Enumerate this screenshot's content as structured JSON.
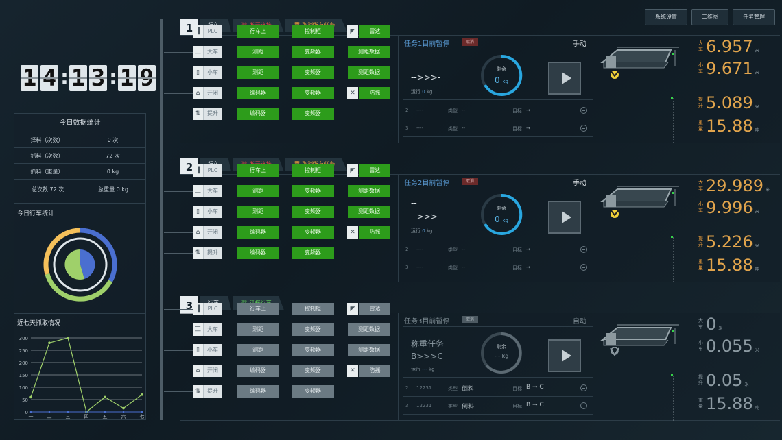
{
  "clock": {
    "digits": [
      "1",
      "4",
      "1",
      "3",
      "1",
      "9"
    ]
  },
  "top_buttons": [
    "系统设置",
    "二维图",
    "任务管理"
  ],
  "stats": {
    "title": "今日数据统计",
    "rows": [
      {
        "label": "择料（次数）",
        "value": "0 次"
      },
      {
        "label": "抓料（次数）",
        "value": "72 次"
      },
      {
        "label": "抓料（重量）",
        "value": "0 kg"
      }
    ],
    "total_count": "总次数  72 次",
    "total_weight": "总重量  0 kg"
  },
  "donut": {
    "title": "今日行车统计",
    "colors": [
      "#4a6fd0",
      "#9fd06a",
      "#f5c05a"
    ]
  },
  "line_chart": {
    "title": "近七天抓取情况"
  },
  "chart_data": {
    "type": "line",
    "title": "近七天抓取情况",
    "categories": [
      "一",
      "二",
      "三",
      "四",
      "五",
      "六",
      "七"
    ],
    "values": [
      60,
      280,
      300,
      0,
      60,
      15,
      70
    ],
    "ylim": [
      0,
      300
    ],
    "yticks": [
      0,
      50,
      100,
      150,
      200,
      250,
      300
    ],
    "grid": true,
    "color": "#9fd06a"
  },
  "sections": [
    {
      "num": "1",
      "tabs": [
        "行车",
        "断开连接",
        "取消所有任务"
      ],
      "devices": [
        "PLC",
        "大车",
        "小车",
        "开闭",
        "提升"
      ],
      "col1": [
        "行车上",
        "测距",
        "测距",
        "编码器",
        "编码器"
      ],
      "col2": [
        "控制柜",
        "变频器",
        "变频器",
        "变频器",
        "变频器"
      ],
      "col3": [
        "雷达",
        "测距数据",
        "测距数据",
        "防摇"
      ],
      "task": {
        "title": "任务1目前暂停",
        "cancel": "取消",
        "mode": "手动",
        "line1": "--",
        "line2": "-->>>-",
        "run": "运行",
        "run_val": "0",
        "run_unit": "kg",
        "gauge_label": "剩余",
        "gauge_value": "0",
        "gauge_unit": "kg",
        "rows": [
          {
            "n": "2",
            "id": "----",
            "type_l": "类型",
            "type_v": "--",
            "tgt_l": "目标",
            "tgt_v": "→"
          },
          {
            "n": "3",
            "id": "----",
            "type_l": "类型",
            "type_v": "--",
            "tgt_l": "目标",
            "tgt_v": "→"
          }
        ]
      },
      "readouts": [
        {
          "label": "大车",
          "value": "6.957",
          "unit": "米"
        },
        {
          "label": "小车",
          "value": "9.671",
          "unit": "米"
        },
        {
          "label": "提升",
          "value": "5.089",
          "unit": "米"
        },
        {
          "label": "重量",
          "value": "15.88",
          "unit": "吨"
        }
      ]
    },
    {
      "num": "2",
      "tabs": [
        "行车",
        "断开连接",
        "取消所有任务"
      ],
      "devices": [
        "PLC",
        "大车",
        "小车",
        "开闭",
        "提升"
      ],
      "col1": [
        "行车上",
        "测距",
        "测距",
        "编码器",
        "编码器"
      ],
      "col2": [
        "控制柜",
        "变频器",
        "变频器",
        "变频器",
        "变频器"
      ],
      "col3": [
        "雷达",
        "测距数据",
        "测距数据",
        "防摇"
      ],
      "task": {
        "title": "任务2目前暂停",
        "cancel": "取消",
        "mode": "手动",
        "line1": "--",
        "line2": "-->>>-",
        "run": "运行",
        "run_val": "0",
        "run_unit": "kg",
        "gauge_label": "剩余",
        "gauge_value": "0",
        "gauge_unit": "kg",
        "rows": [
          {
            "n": "2",
            "id": "----",
            "type_l": "类型",
            "type_v": "--",
            "tgt_l": "目标",
            "tgt_v": "→"
          },
          {
            "n": "3",
            "id": "----",
            "type_l": "类型",
            "type_v": "--",
            "tgt_l": "目标",
            "tgt_v": "→"
          }
        ]
      },
      "readouts": [
        {
          "label": "大车",
          "value": "29.989",
          "unit": "米"
        },
        {
          "label": "小车",
          "value": "9.996",
          "unit": "米"
        },
        {
          "label": "提升",
          "value": "5.226",
          "unit": "米"
        },
        {
          "label": "重量",
          "value": "15.88",
          "unit": "吨"
        }
      ]
    },
    {
      "num": "3",
      "tabs": [
        "行车",
        "连接行车"
      ],
      "devices": [
        "PLC",
        "大车",
        "小车",
        "开闭",
        "提升"
      ],
      "col1": [
        "行车上",
        "测距",
        "测距",
        "编码器",
        "编码器"
      ],
      "col2": [
        "控制柜",
        "变频器",
        "变频器",
        "变频器",
        "变频器"
      ],
      "col3": [
        "雷达",
        "测距数据",
        "测距数据",
        "防摇"
      ],
      "task": {
        "title": "任务3目前暂停",
        "cancel": "取消",
        "mode": "自动",
        "line1": "称重任务",
        "line2": "B>>>C",
        "run": "运行",
        "run_val": "---",
        "run_unit": "kg",
        "gauge_label": "剩余",
        "gauge_value": "- - kg",
        "gauge_unit": "",
        "rows": [
          {
            "n": "2",
            "id": "12231",
            "type_l": "类型",
            "type_v": "倒料",
            "tgt_l": "目标",
            "tgt_v": "B → C"
          },
          {
            "n": "3",
            "id": "12231",
            "type_l": "类型",
            "type_v": "倒料",
            "tgt_l": "目标",
            "tgt_v": "B → C"
          }
        ]
      },
      "readouts": [
        {
          "label": "大车",
          "value": "0",
          "unit": "米"
        },
        {
          "label": "小车",
          "value": "0.055",
          "unit": "米"
        },
        {
          "label": "提升",
          "value": "0.05",
          "unit": "米"
        },
        {
          "label": "重量",
          "value": "15.88",
          "unit": "吨"
        }
      ]
    }
  ]
}
